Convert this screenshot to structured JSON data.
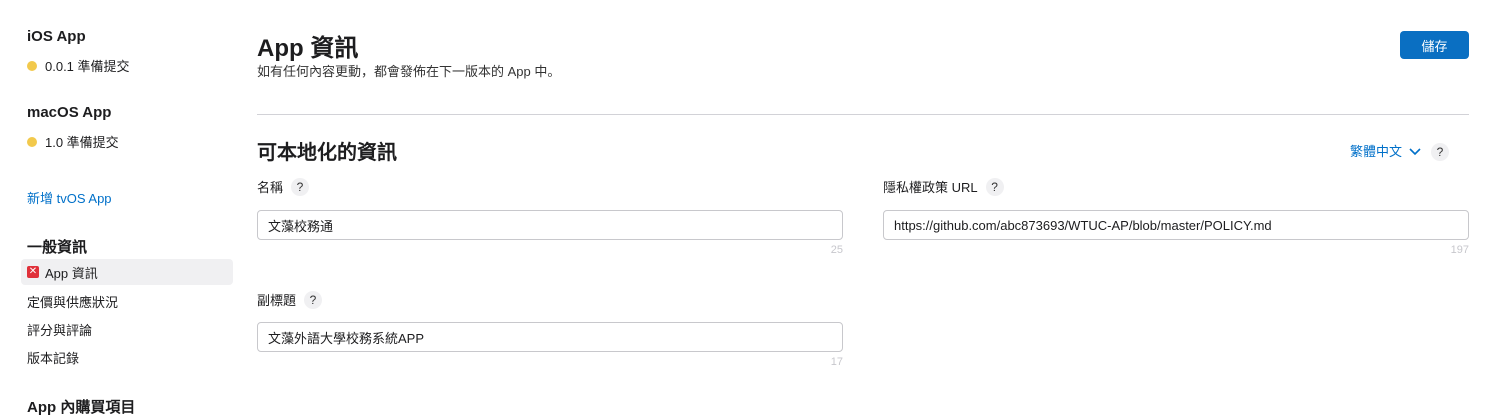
{
  "sidebar": {
    "ios": {
      "title": "iOS App",
      "status": "0.0.1 準備提交"
    },
    "macos": {
      "title": "macOS App",
      "status": "1.0 準備提交"
    },
    "add_tvos": "新增 tvOS App",
    "general": {
      "title": "一般資訊",
      "items": [
        {
          "label": "App 資訊"
        },
        {
          "label": "定價與供應狀況"
        },
        {
          "label": "評分與評論"
        },
        {
          "label": "版本記錄"
        }
      ]
    },
    "iap_title": "App 內購買項目"
  },
  "header": {
    "title": "App 資訊",
    "subtitle": "如有任何內容更動，都會發佈在下一版本的 App 中。",
    "save_label": "儲存"
  },
  "localizable": {
    "title": "可本地化的資訊",
    "language": "繁體中文",
    "name": {
      "label": "名稱",
      "value": "文藻校務通",
      "remaining": "25"
    },
    "subtitle": {
      "label": "副標題",
      "value": "文藻外語大學校務系統APP",
      "remaining": "17"
    },
    "privacy": {
      "label": "隱私權政策 URL",
      "value": "https://github.com/abc873693/WTUC-AP/blob/master/POLICY.md",
      "remaining": "197"
    }
  },
  "help_glyph": "?",
  "icons": {
    "status_dot": "#f2c94c",
    "error_badge": "#e0303a",
    "accent": "#0070c9"
  }
}
